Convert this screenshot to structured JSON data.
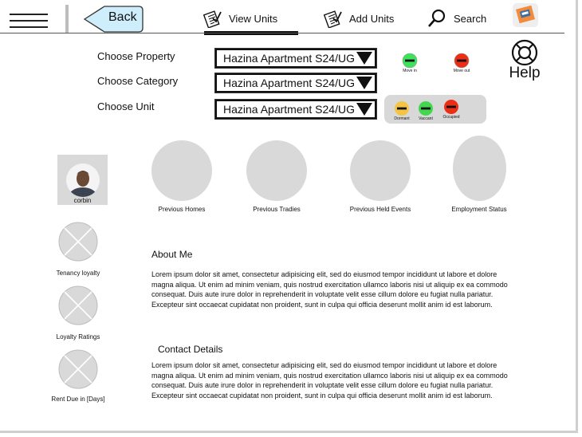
{
  "header": {
    "back_label": "Back",
    "nav": [
      {
        "label": "View Units",
        "icon": "clipboard-check-icon"
      },
      {
        "label": "Add Units",
        "icon": "clipboard-check-icon"
      },
      {
        "label": "Search",
        "icon": "search-icon"
      }
    ]
  },
  "filters": {
    "property_label": "Choose Property",
    "property_value": "Hazina Apartment S24/UG",
    "category_label": "Choose Category",
    "category_value": "Hazina Apartment S24/UG",
    "unit_label": "Choose Unit",
    "unit_value": "Hazina Apartment S24/UG"
  },
  "movement_legend": [
    {
      "label": "Move in",
      "color": "#3de35a"
    },
    {
      "label": "Move out",
      "color": "#ee2d16"
    }
  ],
  "status_legend": [
    {
      "label": "Dormant",
      "color": "#f6c445"
    },
    {
      "label": "Vaccant",
      "color": "#42d74f"
    },
    {
      "label": "Occupied",
      "color": "#ee2d16"
    }
  ],
  "help_label": "Help",
  "profile": {
    "name": "corbin"
  },
  "stats": [
    {
      "label": "Previous Homes"
    },
    {
      "label": "Previous Tradies"
    },
    {
      "label": "Previous Held Events"
    },
    {
      "label": "Employment Status"
    }
  ],
  "ratings": [
    {
      "label": "Tenancy loyalty"
    },
    {
      "label": "Loyalty Ratings"
    },
    {
      "label": "Rent Due in [Days]"
    }
  ],
  "about": {
    "title": "About Me",
    "text": "Lorem ipsum dolor sit amet, consectetur adipisicing elit, sed do eiusmod tempor incididunt ut labore et dolore magna aliqua. Ut enim ad minim veniam, quis nostrud exercitation ullamco laboris nisi ut aliquip ex ea commodo consequat. Duis aute irure dolor in reprehenderit in voluptate velit esse cillum dolore eu fugiat nulla pariatur. Excepteur sint occaecat cupidatat non proident, sunt in culpa qui officia deserunt mollit anim id est laborum."
  },
  "contact": {
    "title": "Contact Details",
    "text": "Lorem ipsum dolor sit amet, consectetur adipisicing elit, sed do eiusmod tempor incididunt ut labore et dolore magna aliqua. Ut enim ad minim veniam, quis nostrud exercitation ullamco laboris nisi ut aliquip ex ea commodo consequat. Duis aute irure dolor in reprehenderit in voluptate velit esse cillum dolore eu fugiat nulla pariatur. Excepteur sint occaecat cupidatat non proident, sunt in culpa qui officia deserunt mollit anim id est laborum."
  }
}
